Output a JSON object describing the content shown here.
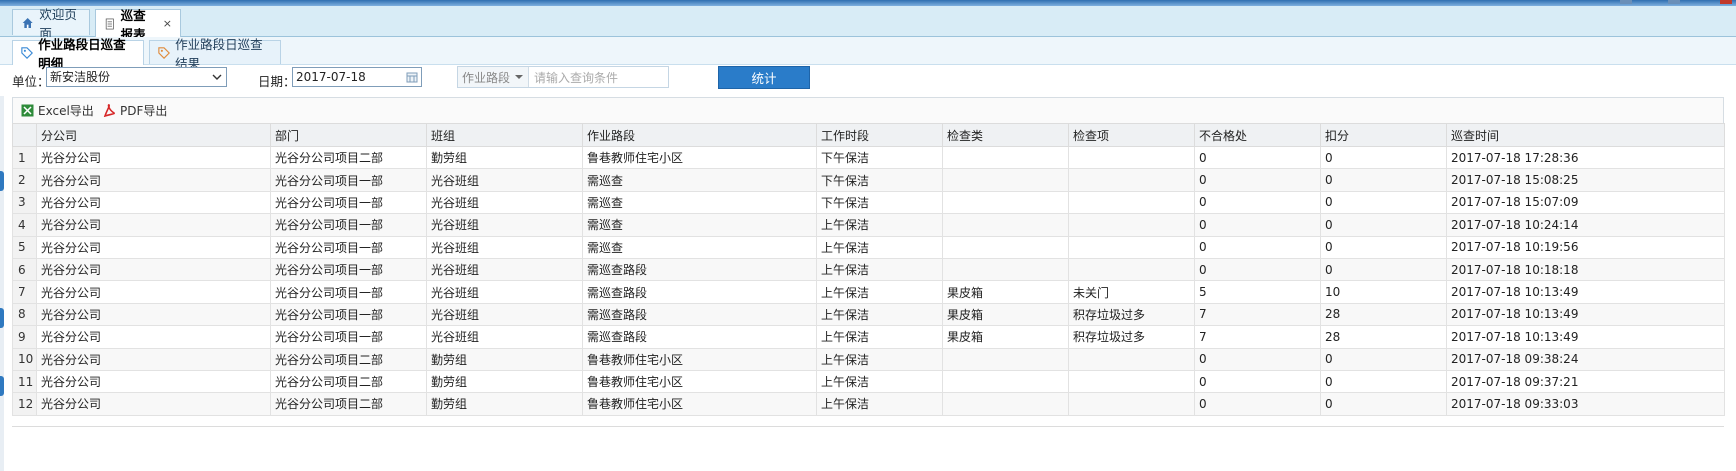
{
  "main_tabs": [
    {
      "label": "欢迎页面",
      "icon": "home-icon"
    },
    {
      "label": "巡查报表",
      "icon": "report-icon",
      "close": "×"
    }
  ],
  "sub_tabs": [
    {
      "label": "作业路段日巡查明细",
      "icon": "tag-icon"
    },
    {
      "label": "作业路段日巡查结果",
      "icon": "tag-icon"
    }
  ],
  "filters": {
    "unit_label": "单位：",
    "unit_value": "新安洁股份",
    "date_label": "日期：",
    "date_value": "2017-07-18",
    "field_select": "作业路段",
    "query_placeholder": "请输入查询条件",
    "stat_button": "统计"
  },
  "toolbar": {
    "excel_label": "Excel导出",
    "pdf_label": "PDF导出"
  },
  "table": {
    "columns": [
      "分公司",
      "部门",
      "班组",
      "作业路段",
      "工作时段",
      "检查类",
      "检查项",
      "不合格处",
      "扣分",
      "巡查时间"
    ],
    "rows": [
      [
        "1",
        "光谷分公司",
        "光谷分公司项目二部",
        "勤劳组",
        "鲁巷教师住宅小区",
        "下午保洁",
        "",
        "",
        "0",
        "0",
        "2017-07-18 17:28:36"
      ],
      [
        "2",
        "光谷分公司",
        "光谷分公司项目一部",
        "光谷班组",
        "需巡查",
        "下午保洁",
        "",
        "",
        "0",
        "0",
        "2017-07-18 15:08:25"
      ],
      [
        "3",
        "光谷分公司",
        "光谷分公司项目一部",
        "光谷班组",
        "需巡查",
        "下午保洁",
        "",
        "",
        "0",
        "0",
        "2017-07-18 15:07:09"
      ],
      [
        "4",
        "光谷分公司",
        "光谷分公司项目一部",
        "光谷班组",
        "需巡查",
        "上午保洁",
        "",
        "",
        "0",
        "0",
        "2017-07-18 10:24:14"
      ],
      [
        "5",
        "光谷分公司",
        "光谷分公司项目一部",
        "光谷班组",
        "需巡查",
        "上午保洁",
        "",
        "",
        "0",
        "0",
        "2017-07-18 10:19:56"
      ],
      [
        "6",
        "光谷分公司",
        "光谷分公司项目一部",
        "光谷班组",
        "需巡查路段",
        "上午保洁",
        "",
        "",
        "0",
        "0",
        "2017-07-18 10:18:18"
      ],
      [
        "7",
        "光谷分公司",
        "光谷分公司项目一部",
        "光谷班组",
        "需巡查路段",
        "上午保洁",
        "果皮箱",
        "未关门",
        "5",
        "10",
        "2017-07-18 10:13:49"
      ],
      [
        "8",
        "光谷分公司",
        "光谷分公司项目一部",
        "光谷班组",
        "需巡查路段",
        "上午保洁",
        "果皮箱",
        "积存垃圾过多",
        "7",
        "28",
        "2017-07-18 10:13:49"
      ],
      [
        "9",
        "光谷分公司",
        "光谷分公司项目一部",
        "光谷班组",
        "需巡查路段",
        "上午保洁",
        "果皮箱",
        "积存垃圾过多",
        "7",
        "28",
        "2017-07-18 10:13:49"
      ],
      [
        "10",
        "光谷分公司",
        "光谷分公司项目二部",
        "勤劳组",
        "鲁巷教师住宅小区",
        "上午保洁",
        "",
        "",
        "0",
        "0",
        "2017-07-18 09:38:24"
      ],
      [
        "11",
        "光谷分公司",
        "光谷分公司项目二部",
        "勤劳组",
        "鲁巷教师住宅小区",
        "上午保洁",
        "",
        "",
        "0",
        "0",
        "2017-07-18 09:37:21"
      ],
      [
        "12",
        "光谷分公司",
        "光谷分公司项目二部",
        "勤劳组",
        "鲁巷教师住宅小区",
        "上午保洁",
        "",
        "",
        "0",
        "0",
        "2017-07-18 09:33:03"
      ]
    ]
  },
  "colors": {
    "accent": "#2a7cc9",
    "tabbar": "#d8ecf6"
  }
}
